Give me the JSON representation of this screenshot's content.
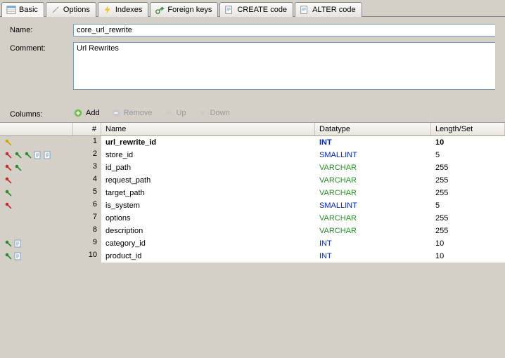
{
  "tabs": {
    "basic": "Basic",
    "options": "Options",
    "indexes": "Indexes",
    "foreign_keys": "Foreign keys",
    "create_code": "CREATE code",
    "alter_code": "ALTER code"
  },
  "form": {
    "name_label": "Name:",
    "name_value": "core_url_rewrite",
    "comment_label": "Comment:",
    "comment_value": "Url Rewrites"
  },
  "columns_label": "Columns:",
  "toolbar": {
    "add": "Add",
    "remove": "Remove",
    "up": "Up",
    "down": "Down"
  },
  "grid": {
    "headers": {
      "num": "#",
      "name": "Name",
      "datatype": "Datatype",
      "len": "Length/Set"
    },
    "rows": [
      {
        "num": 1,
        "name": "url_rewrite_id",
        "datatype": "INT",
        "typeclass": "t-int",
        "len": "10",
        "bold": true,
        "keys": [
          "y"
        ]
      },
      {
        "num": 2,
        "name": "store_id",
        "datatype": "SMALLINT",
        "typeclass": "t-int",
        "len": "5",
        "keys": [
          "r",
          "g",
          "g",
          "doc",
          "doc"
        ]
      },
      {
        "num": 3,
        "name": "id_path",
        "datatype": "VARCHAR",
        "typeclass": "t-var",
        "len": "255",
        "keys": [
          "r",
          "g"
        ]
      },
      {
        "num": 4,
        "name": "request_path",
        "datatype": "VARCHAR",
        "typeclass": "t-var",
        "len": "255",
        "keys": [
          "r"
        ]
      },
      {
        "num": 5,
        "name": "target_path",
        "datatype": "VARCHAR",
        "typeclass": "t-var",
        "len": "255",
        "keys": [
          "g"
        ]
      },
      {
        "num": 6,
        "name": "is_system",
        "datatype": "SMALLINT",
        "typeclass": "t-int",
        "len": "5",
        "keys": [
          "r"
        ]
      },
      {
        "num": 7,
        "name": "options",
        "datatype": "VARCHAR",
        "typeclass": "t-var",
        "len": "255",
        "keys": []
      },
      {
        "num": 8,
        "name": "description",
        "datatype": "VARCHAR",
        "typeclass": "t-var",
        "len": "255",
        "keys": []
      },
      {
        "num": 9,
        "name": "category_id",
        "datatype": "INT",
        "typeclass": "t-int",
        "len": "10",
        "keys": [
          "g",
          "doc"
        ]
      },
      {
        "num": 10,
        "name": "product_id",
        "datatype": "INT",
        "typeclass": "t-int",
        "len": "10",
        "keys": [
          "g",
          "doc"
        ]
      }
    ]
  }
}
